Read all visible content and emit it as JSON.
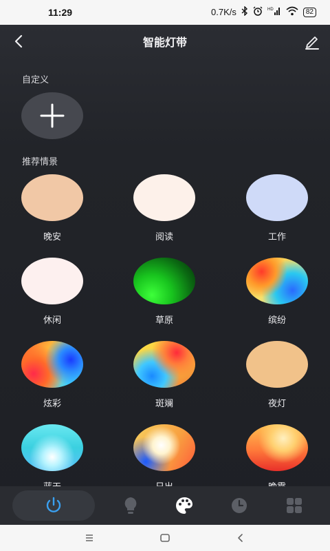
{
  "status_bar": {
    "time": "11:29",
    "network_speed": "0.7K/s",
    "battery": "82",
    "icons": [
      "bluetooth-icon",
      "alarm-icon",
      "signal-icon",
      "wifi-icon",
      "battery-icon"
    ]
  },
  "header": {
    "title": "智能灯带",
    "back_icon": "chevron-left-icon",
    "edit_icon": "pencil-icon"
  },
  "custom_section": {
    "label": "自定义",
    "add_icon": "plus-icon"
  },
  "recommend_section": {
    "label": "推荐情景",
    "scenes": [
      {
        "name": "晚安",
        "color": "#f1c8a6"
      },
      {
        "name": "阅读",
        "color": "#fdf1ea"
      },
      {
        "name": "工作",
        "color": "#cfdaf8"
      },
      {
        "name": "休闲",
        "color": "#fdf0ef"
      },
      {
        "name": "草原",
        "color": "#22b42a"
      },
      {
        "name": "缤纷",
        "color": "#f0a030"
      },
      {
        "name": "炫彩",
        "color": "#e84a2a"
      },
      {
        "name": "斑斓",
        "color": "#f3c03a"
      },
      {
        "name": "夜灯",
        "color": "#f1c28a"
      },
      {
        "name": "蓝天",
        "color": "#5fe0ea"
      },
      {
        "name": "日出",
        "color": "#f6c860"
      },
      {
        "name": "晚霞",
        "color": "#f05a3a"
      }
    ]
  },
  "tab_bar": {
    "tabs": [
      {
        "icon": "power-icon",
        "active": true,
        "color": "#3aa0f0"
      },
      {
        "icon": "bulb-icon",
        "active": false
      },
      {
        "icon": "palette-icon",
        "active": false
      },
      {
        "icon": "clock-icon",
        "active": false
      },
      {
        "icon": "grid-icon",
        "active": false
      }
    ]
  },
  "nav_bar": {
    "buttons": [
      "menu-icon",
      "home-icon",
      "back-icon"
    ]
  }
}
